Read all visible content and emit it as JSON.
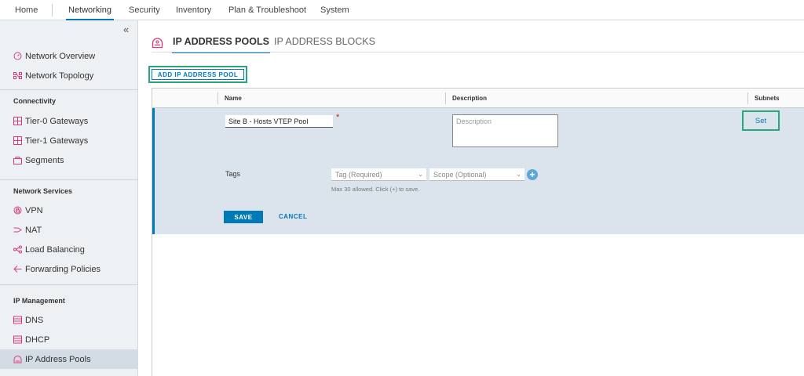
{
  "topnav": {
    "tabs": [
      "Home",
      "Networking",
      "Security",
      "Inventory",
      "Plan & Troubleshoot",
      "System"
    ],
    "active": "Networking"
  },
  "sidebar": {
    "collapse_glyph": "«",
    "items": [
      {
        "label": "Network Overview",
        "icon": "gauge-icon"
      },
      {
        "label": "Network Topology",
        "icon": "topology-icon"
      }
    ],
    "sections": [
      {
        "heading": "Connectivity",
        "items": [
          {
            "label": "Tier-0 Gateways",
            "icon": "tier0-gateway-icon"
          },
          {
            "label": "Tier-1 Gateways",
            "icon": "tier1-gateway-icon"
          },
          {
            "label": "Segments",
            "icon": "segments-icon"
          }
        ]
      },
      {
        "heading": "Network Services",
        "items": [
          {
            "label": "VPN",
            "icon": "vpn-icon"
          },
          {
            "label": "NAT",
            "icon": "nat-icon"
          },
          {
            "label": "Load Balancing",
            "icon": "load-balancing-icon"
          },
          {
            "label": "Forwarding Policies",
            "icon": "forwarding-icon"
          }
        ]
      },
      {
        "heading": "IP Management",
        "items": [
          {
            "label": "DNS",
            "icon": "dns-icon"
          },
          {
            "label": "DHCP",
            "icon": "dhcp-icon"
          },
          {
            "label": "IP Address Pools",
            "icon": "ip-pool-icon",
            "selected": true
          }
        ]
      }
    ]
  },
  "page": {
    "tabs": [
      "IP ADDRESS POOLS",
      "IP ADDRESS BLOCKS"
    ],
    "active_tab": "IP ADDRESS POOLS",
    "add_button": "ADD IP ADDRESS POOL"
  },
  "grid": {
    "columns": [
      "Name",
      "Description",
      "Subnets"
    ],
    "edit_row": {
      "name_value": "Site B - Hosts VTEP Pool",
      "required_marker": "*",
      "description_placeholder": "Description",
      "subnets_link": "Set",
      "tags_label": "Tags",
      "tag_placeholder": "Tag (Required)",
      "scope_placeholder": "Scope (Optional)",
      "add_tag_glyph": "+",
      "tags_hint": "Max 30 allowed. Click (+) to save.",
      "save_label": "SAVE",
      "cancel_label": "CANCEL"
    }
  },
  "colors": {
    "accent": "#0079b8",
    "highlight": "#28a87a",
    "icon": "#d93a7a",
    "edit_row_bg": "#dbe4ec"
  }
}
